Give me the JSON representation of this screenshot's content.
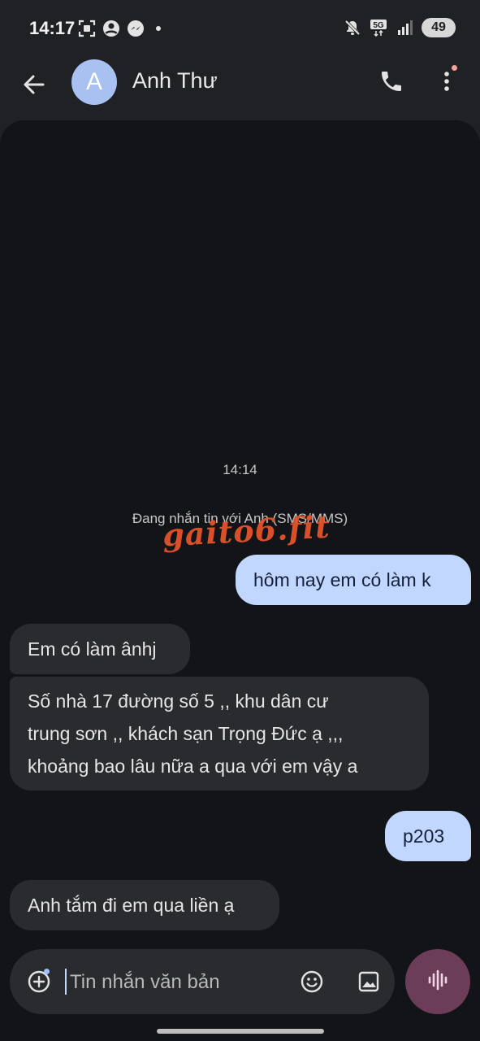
{
  "status_bar": {
    "time": "14:17",
    "left_icons": [
      "screenshot-icon",
      "face-icon",
      "messenger-icon"
    ],
    "right_icons": [
      "mute-icon",
      "5g-icon",
      "signal-icon"
    ],
    "network_label": "5G",
    "battery": "49"
  },
  "app_bar": {
    "avatar_letter": "A",
    "contact_name": "Anh Thư"
  },
  "conversation": {
    "timestamp": "14:14",
    "mode_note": "Đang nhắn tin với Anh (SMS/MMS)",
    "watermark": "gaito6.fit",
    "messages": [
      {
        "direction": "outgoing",
        "text": "hôm nay em có làm k"
      },
      {
        "direction": "incoming",
        "text": "Em có làm ânhj"
      },
      {
        "direction": "incoming",
        "lines": [
          "Số nhà 17 đường số 5 ,, khu dân cư",
          "trung sơn ,, khách sạn Trọng Đức ạ ,,,",
          "khoảng bao lâu nữa a qua với em vậy a"
        ]
      },
      {
        "direction": "outgoing",
        "text": "p203"
      },
      {
        "direction": "incoming",
        "text": "Anh tắm đi em qua liền ạ"
      }
    ]
  },
  "composer": {
    "placeholder": "Tin nhắn văn bản",
    "value": ""
  },
  "colors": {
    "background": "#131417",
    "outgoing_bubble": "#c2d7fd",
    "incoming_bubble": "#2a2b2f",
    "voice_button": "#6c3d59",
    "watermark": "#e2542a"
  }
}
